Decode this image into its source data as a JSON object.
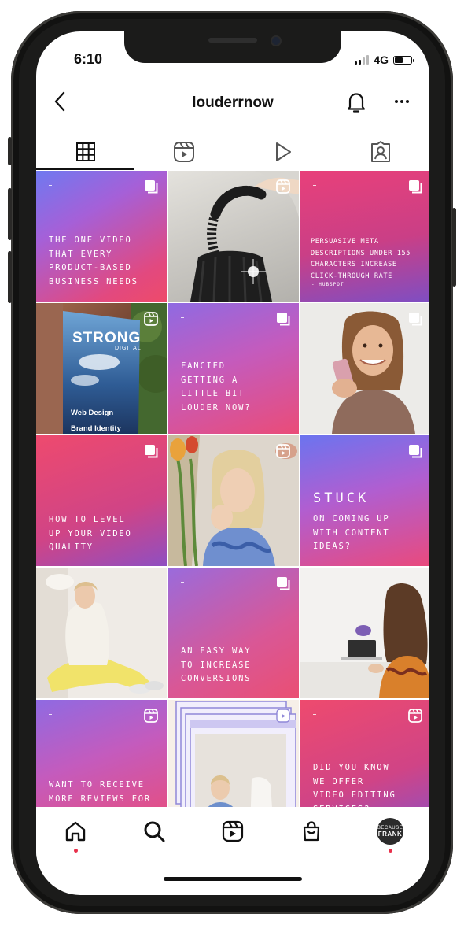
{
  "status_bar": {
    "time": "6:10",
    "network": "4G",
    "battery_level": 0.55
  },
  "header": {
    "title": "louderrnow",
    "back_icon": "chevron-left-icon",
    "notifications_icon": "bell-icon",
    "more_icon": "more-horizontal-icon"
  },
  "tabs": [
    {
      "icon": "grid-icon",
      "active": true
    },
    {
      "icon": "reels-icon",
      "active": false
    },
    {
      "icon": "play-icon",
      "active": false
    },
    {
      "icon": "tagged-user-icon",
      "active": false
    }
  ],
  "posts": {
    "p1": {
      "text": "THE ONE VIDEO\nTHAT EVERY\nPRODUCT-BASED\nBUSINESS NEEDS",
      "badge": "carousel-icon"
    },
    "p2": {
      "badge": "reel-icon",
      "desc": "photo"
    },
    "p3": {
      "text": "PERSUASIVE META\nDESCRIPTIONS UNDER 155\nCHARACTERS INCREASE\nCLICK-THROUGH RATE",
      "note": "- HUBSPOT",
      "badge": "carousel-icon"
    },
    "p4": {
      "brand": "STRONG",
      "brand_sub": "DIGITAL",
      "line1": "Web Design",
      "line2": "Brand Identity",
      "badge": "reel-icon"
    },
    "p5": {
      "text": "FANCIED\nGETTING A\nLITTLE BIT\nLOUDER NOW?",
      "badge": "carousel-icon"
    },
    "p6": {
      "badge": "carousel-icon",
      "desc": "photo"
    },
    "p7": {
      "text": "HOW TO LEVEL\nUP YOUR VIDEO\nQUALITY",
      "badge": "carousel-icon"
    },
    "p8": {
      "badge": "reel-icon",
      "desc": "photo"
    },
    "p9": {
      "heading": "STUCK",
      "text": "ON COMING UP\nWITH CONTENT\nIDEAS?",
      "badge": "carousel-icon"
    },
    "p10": {
      "desc": "photo"
    },
    "p11": {
      "text": "AN EASY WAY\nTO INCREASE\nCONVERSIONS",
      "badge": "carousel-icon"
    },
    "p12": {
      "desc": "photo"
    },
    "p13": {
      "text": "WANT TO RECEIVE\nMORE REVIEWS FOR",
      "badge": "reel-icon"
    },
    "p14": {
      "badge": "reel-icon",
      "desc": "photo"
    },
    "p15": {
      "text": "DID YOU KNOW\nWE OFFER\nVIDEO EDITING\nSERVICES?",
      "badge": "reel-icon"
    }
  },
  "bottom_nav": [
    {
      "icon": "home-icon",
      "dot": true
    },
    {
      "icon": "search-icon",
      "dot": false
    },
    {
      "icon": "reels-icon",
      "dot": false
    },
    {
      "icon": "shop-icon",
      "dot": false
    },
    {
      "icon": "profile-avatar",
      "dot": true
    }
  ],
  "avatar": {
    "line1": "BECAUSE",
    "line2": "FRANK"
  }
}
